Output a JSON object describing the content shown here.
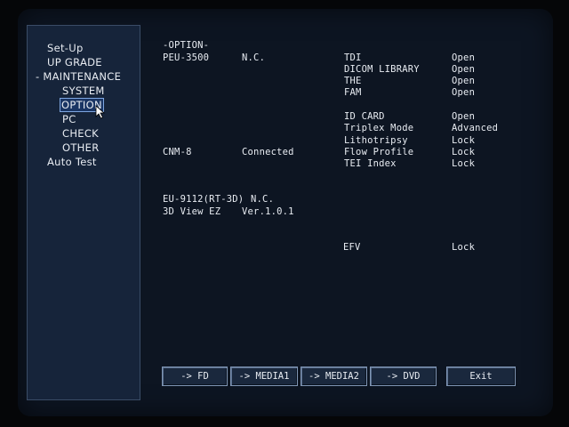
{
  "sidebar": {
    "items": [
      {
        "label": "Set-Up"
      },
      {
        "label": "UP GRADE"
      },
      {
        "label": "-  MAINTENANCE"
      },
      {
        "label": "SYSTEM"
      },
      {
        "label": "OPTION"
      },
      {
        "label": "PC"
      },
      {
        "label": "CHECK"
      },
      {
        "label": "OTHER"
      },
      {
        "label": "Auto Test"
      }
    ],
    "selected": "OPTION"
  },
  "main": {
    "header": "-OPTION-",
    "devices": [
      {
        "name": "PEU-3500",
        "status": "N.C."
      },
      {
        "name": "CNM-8",
        "status": "Connected"
      },
      {
        "name": "EU-9112(RT-3D)",
        "status": "N.C."
      },
      {
        "name": "3D View EZ",
        "status": "Ver.1.0.1"
      }
    ],
    "options": [
      {
        "name": "TDI",
        "status": "Open"
      },
      {
        "name": "DICOM LIBRARY",
        "status": "Open"
      },
      {
        "name": "THE",
        "status": "Open"
      },
      {
        "name": "FAM",
        "status": "Open"
      },
      {
        "name": "ID CARD",
        "status": "Open"
      },
      {
        "name": "Triplex Mode",
        "status": "Advanced"
      },
      {
        "name": "Lithotripsy",
        "status": "Lock"
      },
      {
        "name": "Flow Profile",
        "status": "Lock"
      },
      {
        "name": "TEI Index",
        "status": "Lock"
      },
      {
        "name": "EFV",
        "status": "Lock"
      }
    ]
  },
  "buttons": {
    "fd": "-> FD",
    "media1": "-> MEDIA1",
    "media2": "-> MEDIA2",
    "dvd": "-> DVD",
    "exit": "Exit"
  }
}
